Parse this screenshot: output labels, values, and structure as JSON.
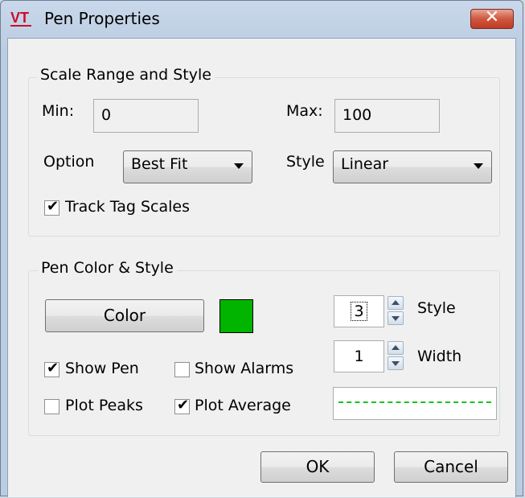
{
  "window": {
    "title": "Pen Properties",
    "app_icon_text": "VT",
    "close_glyph": "✕"
  },
  "scale_group": {
    "title": "Scale Range and Style",
    "min_label": "Min:",
    "min_value": "0",
    "max_label": "Max:",
    "max_value": "100",
    "option_label": "Option",
    "option_value": "Best Fit",
    "style_label": "Style",
    "style_value": "Linear",
    "track_label": "Track Tag Scales",
    "track_checked": true
  },
  "pen_group": {
    "title": "Pen Color & Style",
    "color_button": "Color",
    "swatch_color": "#00b400",
    "style_value": "3",
    "style_label": "Style",
    "width_value": "1",
    "width_label": "Width",
    "show_pen_label": "Show Pen",
    "show_pen_checked": true,
    "show_alarms_label": "Show Alarms",
    "show_alarms_checked": false,
    "plot_peaks_label": "Plot Peaks",
    "plot_peaks_checked": false,
    "plot_average_label": "Plot Average",
    "plot_average_checked": true,
    "preview_line_color": "#19c21f"
  },
  "buttons": {
    "ok": "OK",
    "cancel": "Cancel"
  }
}
